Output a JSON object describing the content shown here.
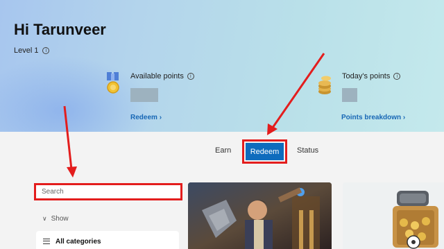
{
  "header": {
    "greeting": "Hi Tarunveer",
    "level": "Level 1"
  },
  "points": {
    "available_label": "Available points",
    "available_link": "Redeem",
    "today_label": "Today's points",
    "today_link": "Points breakdown"
  },
  "tabs": [
    {
      "label": "Earn"
    },
    {
      "label": "Redeem",
      "selected": true
    },
    {
      "label": "Status"
    }
  ],
  "filters": {
    "search_placeholder": "Search",
    "show_label": "Show",
    "category_label": "All categories"
  },
  "colors": {
    "accent": "#0f6cbd",
    "highlight": "#e31d1d",
    "link": "#1767b5"
  },
  "icons": [
    "info-icon",
    "medal-icon",
    "coins-icon",
    "chevron-right-icon",
    "chevron-down-icon",
    "list-icon"
  ]
}
